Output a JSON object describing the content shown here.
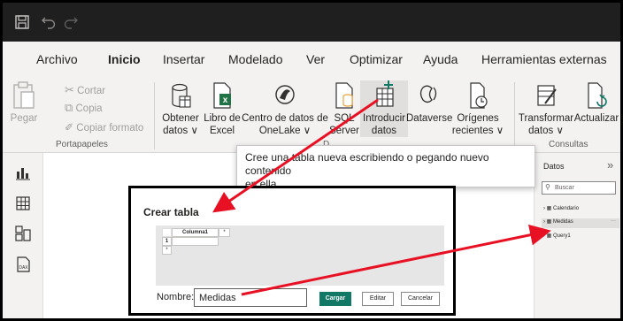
{
  "menu": {
    "items": [
      "Archivo",
      "Inicio",
      "Insertar",
      "Modelado",
      "Ver",
      "Optimizar",
      "Ayuda",
      "Herramientas externas"
    ]
  },
  "ribbon": {
    "portapapeles": {
      "pegar": "Pegar",
      "cortar": "Cortar",
      "copia": "Copia",
      "copiar_formato": "Copiar formato",
      "group_label": "Portapapeles"
    },
    "datos": {
      "obtener_datos_1": "Obtener",
      "obtener_datos_2": "datos ∨",
      "libro_excel_1": "Libro de",
      "libro_excel_2": "Excel",
      "onelake_1": "Centro de datos de",
      "onelake_2": "OneLake ∨",
      "sql_1": "SQL",
      "sql_2": "Server",
      "introducir_1": "Introducir",
      "introducir_2": "datos",
      "dataverse": "Dataverse",
      "origenes_1": "Orígenes",
      "origenes_2": "recientes ∨",
      "group_label": "D"
    },
    "consultas": {
      "transformar_1": "Transformar",
      "transformar_2": "datos ∨",
      "actualizar": "Actualizar",
      "group_label": "Consultas"
    }
  },
  "tooltip": {
    "line1": "Cree una tabla nueva escribiendo o pegando nuevo contenido",
    "line2": "en ella."
  },
  "dialog": {
    "title": "Crear tabla",
    "column_header": "Columna1",
    "add_symbol": "*",
    "row_number": "1",
    "new_row_symbol": "*",
    "name_label": "Nombre:",
    "name_value": "Medidas",
    "load_button": "Cargar",
    "edit_button": "Editar",
    "cancel_button": "Cancelar"
  },
  "data_pane": {
    "title": "Datos",
    "expand_symbol": "»",
    "search_placeholder": "Buscar",
    "tree": [
      "Calendario",
      "Medidas",
      "Query1"
    ],
    "ellipsis": "···"
  },
  "colors": {
    "titlebar": "#1f1f1f",
    "ribbon": "#f3f2f1",
    "accent_green": "#117865",
    "excel_green": "#217346",
    "annotation_arrow": "#e81123"
  }
}
